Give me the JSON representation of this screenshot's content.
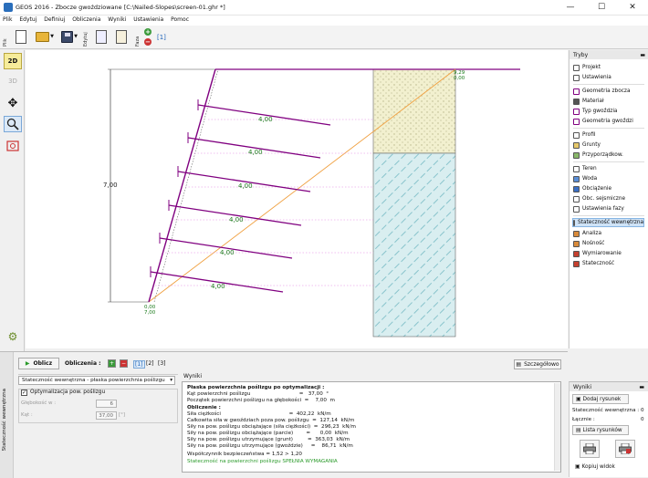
{
  "window": {
    "title": "GEOS 2016 - Zbocze gwoździowane [C:\\Nailed-Slopes\\screen-01.ghr *]",
    "minimize": "—",
    "maximize": "☐",
    "close": "✕"
  },
  "menu": [
    "Plik",
    "Edytuj",
    "Definiuj",
    "Obliczenia",
    "Wyniki",
    "Ustawienia",
    "Pomoc"
  ],
  "toolbar": {
    "group_file": "Plik",
    "group_edit": "Edytuj",
    "group_faza": "Faza"
  },
  "left_tools": {
    "mode_2d": "2D",
    "mode_3d": "3D"
  },
  "drawing": {
    "height_label": "7,00",
    "nail_lengths": [
      "4,00",
      "4,00",
      "4,00",
      "4,00",
      "4,00",
      "4,00"
    ],
    "top_coord": [
      "9,29",
      "0,00"
    ],
    "bottom_coord": [
      "0,00",
      "7,00"
    ],
    "colors": {
      "slope": "#800080",
      "nails": "#800080",
      "slip_surface": "#f0a040",
      "soil_top": "#f2f0cf",
      "soil_bottom": "#d9eef0",
      "dim_text": "#1a7a1a"
    }
  },
  "right_panel": {
    "header": "Tryby",
    "items": [
      {
        "label": "Projekt",
        "icon": "project-icon"
      },
      {
        "label": "Ustawienia",
        "icon": "settings-icon"
      },
      {
        "label": "Geometria zbocza",
        "icon": "slope-geometry-icon"
      },
      {
        "label": "Materiał",
        "icon": "material-icon"
      },
      {
        "label": "Typ gwoździa",
        "icon": "nail-type-icon"
      },
      {
        "label": "Geometria gwoździ",
        "icon": "nail-geometry-icon"
      },
      {
        "label": "Profil",
        "icon": "profile-icon"
      },
      {
        "label": "Grunty",
        "icon": "soils-icon"
      },
      {
        "label": "Przyporządkow.",
        "icon": "assign-icon"
      },
      {
        "label": "Teren",
        "icon": "terrain-icon"
      },
      {
        "label": "Woda",
        "icon": "water-icon"
      },
      {
        "label": "Obciążenie",
        "icon": "load-icon"
      },
      {
        "label": "Obc. sejsmiczne",
        "icon": "seismic-icon"
      },
      {
        "label": "Ustawienia fazy",
        "icon": "phase-settings-icon"
      },
      {
        "label": "Stateczność wewnętrzna",
        "icon": "internal-stability-icon"
      },
      {
        "label": "Analiza",
        "icon": "analysis-icon"
      },
      {
        "label": "Nośność",
        "icon": "bearing-icon"
      },
      {
        "label": "Wymiarowanie",
        "icon": "dimensioning-icon"
      },
      {
        "label": "Stateczność",
        "icon": "stability-icon"
      }
    ]
  },
  "bottom": {
    "side_label": "Stateczność wewnętrzna",
    "compute_button": "Oblicz",
    "calc_label": "Obliczenia :",
    "calc_tabs": [
      "[1]",
      "[2]",
      "[3]"
    ],
    "detail_button": "Szczegółowo",
    "analysis_select": "Stateczność wewnętrzna - płaska powierzchnia poślizgu",
    "optimize_label": "Optymalizacja pow. poślizgu",
    "depth_label": "Głębokość w :",
    "depth_value": "6",
    "angle_label": "Kąt :",
    "angle_value": "37,00",
    "angle_unit": "[°]",
    "results_header": "Wyniki",
    "results_lines": [
      "Płaska powierzchnia poślizgu po optymalizacji :",
      "Kąt powierzchni poślizgu                              =   37,00  °",
      "Początek powierzchni poślizgu na głębokości  =    7,00  m",
      "Obliczenie :",
      "Siła ciężkości                                          =  402,22  kN/m",
      "Całkowita siła w gwoździach poza pow. poślizgu  =  127,14  kN/m",
      "Siły na pow. poślizgu obciążające (siła ciężkości)  =  296,23  kN/m",
      "Siły na pow. poślizgu obciążające (parcie)        =      0,00  kN/m",
      "Siły na pow. poślizgu utrzymujące (grunt)         =  363,03  kN/m",
      "Siły na pow. poślizgu utrzymujące (gwoździe)     =    86,71  kN/m",
      "Współczynnik bezpieczeństwa = 1,52 > 1,20",
      "Stateczność na powierzchni poślizgu SPEŁNIA WYMAGANIA"
    ]
  },
  "wyniki_panel": {
    "header": "Wyniki",
    "add_figure": "Dodaj rysunek",
    "internal_stability": "Stateczność wewnętrzna :",
    "internal_stability_count": "0",
    "total": "Łącznie :",
    "total_count": "0",
    "figure_list": "Lista rysunków",
    "copy_view": "Kopiuj widok"
  }
}
